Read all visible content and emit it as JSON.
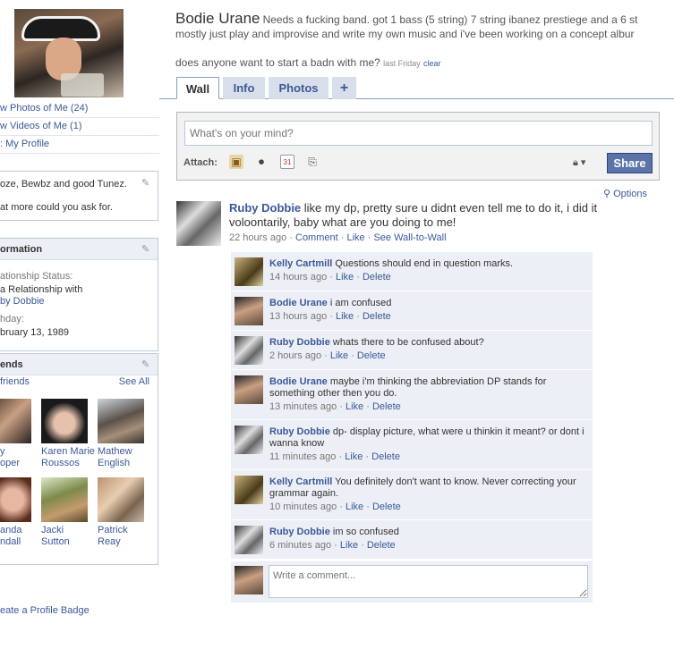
{
  "colors": {
    "link": "#3b5998",
    "share_button": "#5b74a8",
    "comment_bg": "#eceff5",
    "tab_inactive": "#d8dfea"
  },
  "left": {
    "links": [
      "w Photos of Me (24)",
      "w Videos of Me (1)",
      ": My Profile"
    ],
    "quote_lines": [
      "oze, Bewbz and good Tunez.",
      "at more could you ask for."
    ],
    "info": {
      "header": "ormation",
      "relationship_label": "ationship Status:",
      "relationship_value": "a Relationship with",
      "relationship_name": "by Dobbie",
      "birthday_label": "hday:",
      "birthday_value": "bruary 13, 1989"
    },
    "friends": {
      "header": "ends",
      "sub": "friends",
      "see_all": "See All",
      "list": [
        {
          "name": "y\noper"
        },
        {
          "name": "Karen Marie\nRoussos"
        },
        {
          "name": "Mathew\nEnglish"
        },
        {
          "name": "anda\nndall"
        },
        {
          "name": "Jacki\nSutton"
        },
        {
          "name": "Patrick\nReay"
        }
      ]
    },
    "badge": "eate a Profile Badge"
  },
  "header": {
    "name": "Bodie Urane",
    "status_line1": "Needs a fucking band. got 1 bass (5 string) 7 string ibanez prestiege and a 6 st",
    "status_line2": "mostly just play and improvise and write my own music and i've been working on a concept albur",
    "status_line3": "does anyone want to start a badn with me?",
    "status_time": "last Friday",
    "clear_label": "clear"
  },
  "tabs": [
    {
      "label": "Wall"
    },
    {
      "label": "Info"
    },
    {
      "label": "Photos"
    },
    {
      "label": "+"
    }
  ],
  "publisher": {
    "placeholder": "What's on your mind?",
    "attach_label": "Attach:",
    "share_label": "Share"
  },
  "options_label": "Options",
  "post": {
    "author": "Ruby Dobbie",
    "text": " like my dp, pretty sure u didnt even tell me to do it, i did it voloontarily, baby what are you doing to me!",
    "time": "22 hours ago",
    "comment_label": "Comment",
    "like_label": "Like",
    "wall_label": "See Wall-to-Wall"
  },
  "comments": [
    {
      "author": "Kelly Cartmill",
      "text": " Questions should end in question marks.",
      "time": "14 hours ago"
    },
    {
      "author": "Bodie Urane",
      "text": " i am confused",
      "time": "13 hours ago"
    },
    {
      "author": "Ruby Dobbie",
      "text": " whats there to be confused about?",
      "time": "2 hours ago"
    },
    {
      "author": "Bodie Urane",
      "text": " maybe i'm thinking the abbreviation DP stands for something other then you do.",
      "time": "13 minutes ago"
    },
    {
      "author": "Ruby Dobbie",
      "text": " dp- display picture, what were u thinkin it meant? or dont i wanna know",
      "time": "11 minutes ago"
    },
    {
      "author": "Kelly Cartmill",
      "text": " You definitely don't want to know. Never correcting your grammar again.",
      "time": "10 minutes ago"
    },
    {
      "author": "Ruby Dobbie",
      "text": " im so confused",
      "time": "6 minutes ago"
    }
  ],
  "comment_actions": {
    "like": "Like",
    "delete": "Delete"
  },
  "write_comment_placeholder": "Write a comment..."
}
